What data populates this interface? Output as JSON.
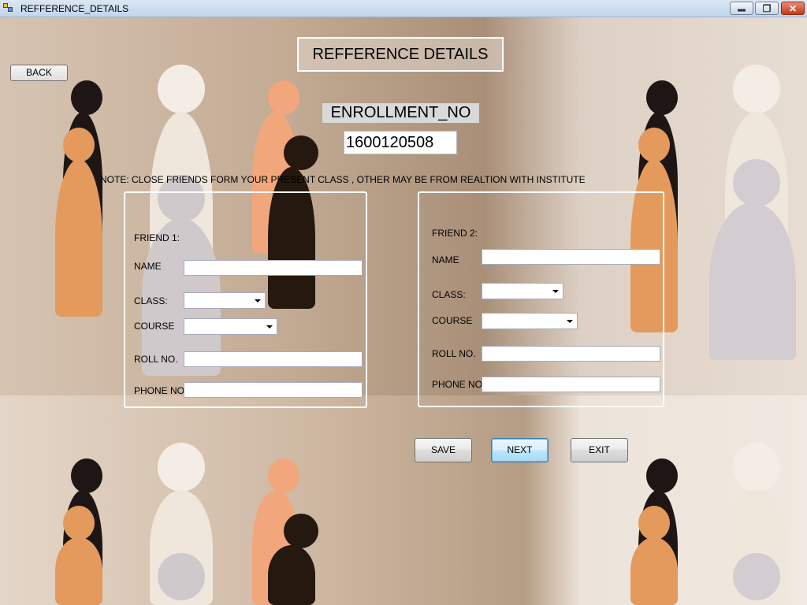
{
  "window": {
    "title": "REFFERENCE_DETAILS",
    "icon": "form-icon",
    "controls": [
      "minimize-icon",
      "restore-icon",
      "close-icon"
    ]
  },
  "header": {
    "title": "REFFERENCE DETAILS",
    "enrollment_label": "ENROLLMENT_NO",
    "enrollment_value": "1600120508"
  },
  "back_label": "BACK",
  "note": "NOTE: CLOSE FRIENDS FORM YOUR PRESENT CLASS , OTHER MAY BE FROM REALTION WITH INSTITUTE",
  "friend1": {
    "heading": "FRIEND 1:",
    "name_label": "NAME",
    "name_value": "",
    "class_label": "CLASS:",
    "class_value": "",
    "course_label": "COURSE",
    "course_value": "",
    "roll_label": "ROLL NO.",
    "roll_value": "",
    "phone_label": "PHONE NO.",
    "phone_value": ""
  },
  "friend2": {
    "heading": "FRIEND 2:",
    "name_label": "NAME",
    "name_value": "",
    "class_label": "CLASS:",
    "class_value": "",
    "course_label": "COURSE",
    "course_value": "",
    "roll_label": "ROLL NO.",
    "roll_value": "",
    "phone_label": "PHONE NO.",
    "phone_value": ""
  },
  "actions": {
    "save_label": "SAVE",
    "next_label": "NEXT",
    "exit_label": "EXIT"
  }
}
